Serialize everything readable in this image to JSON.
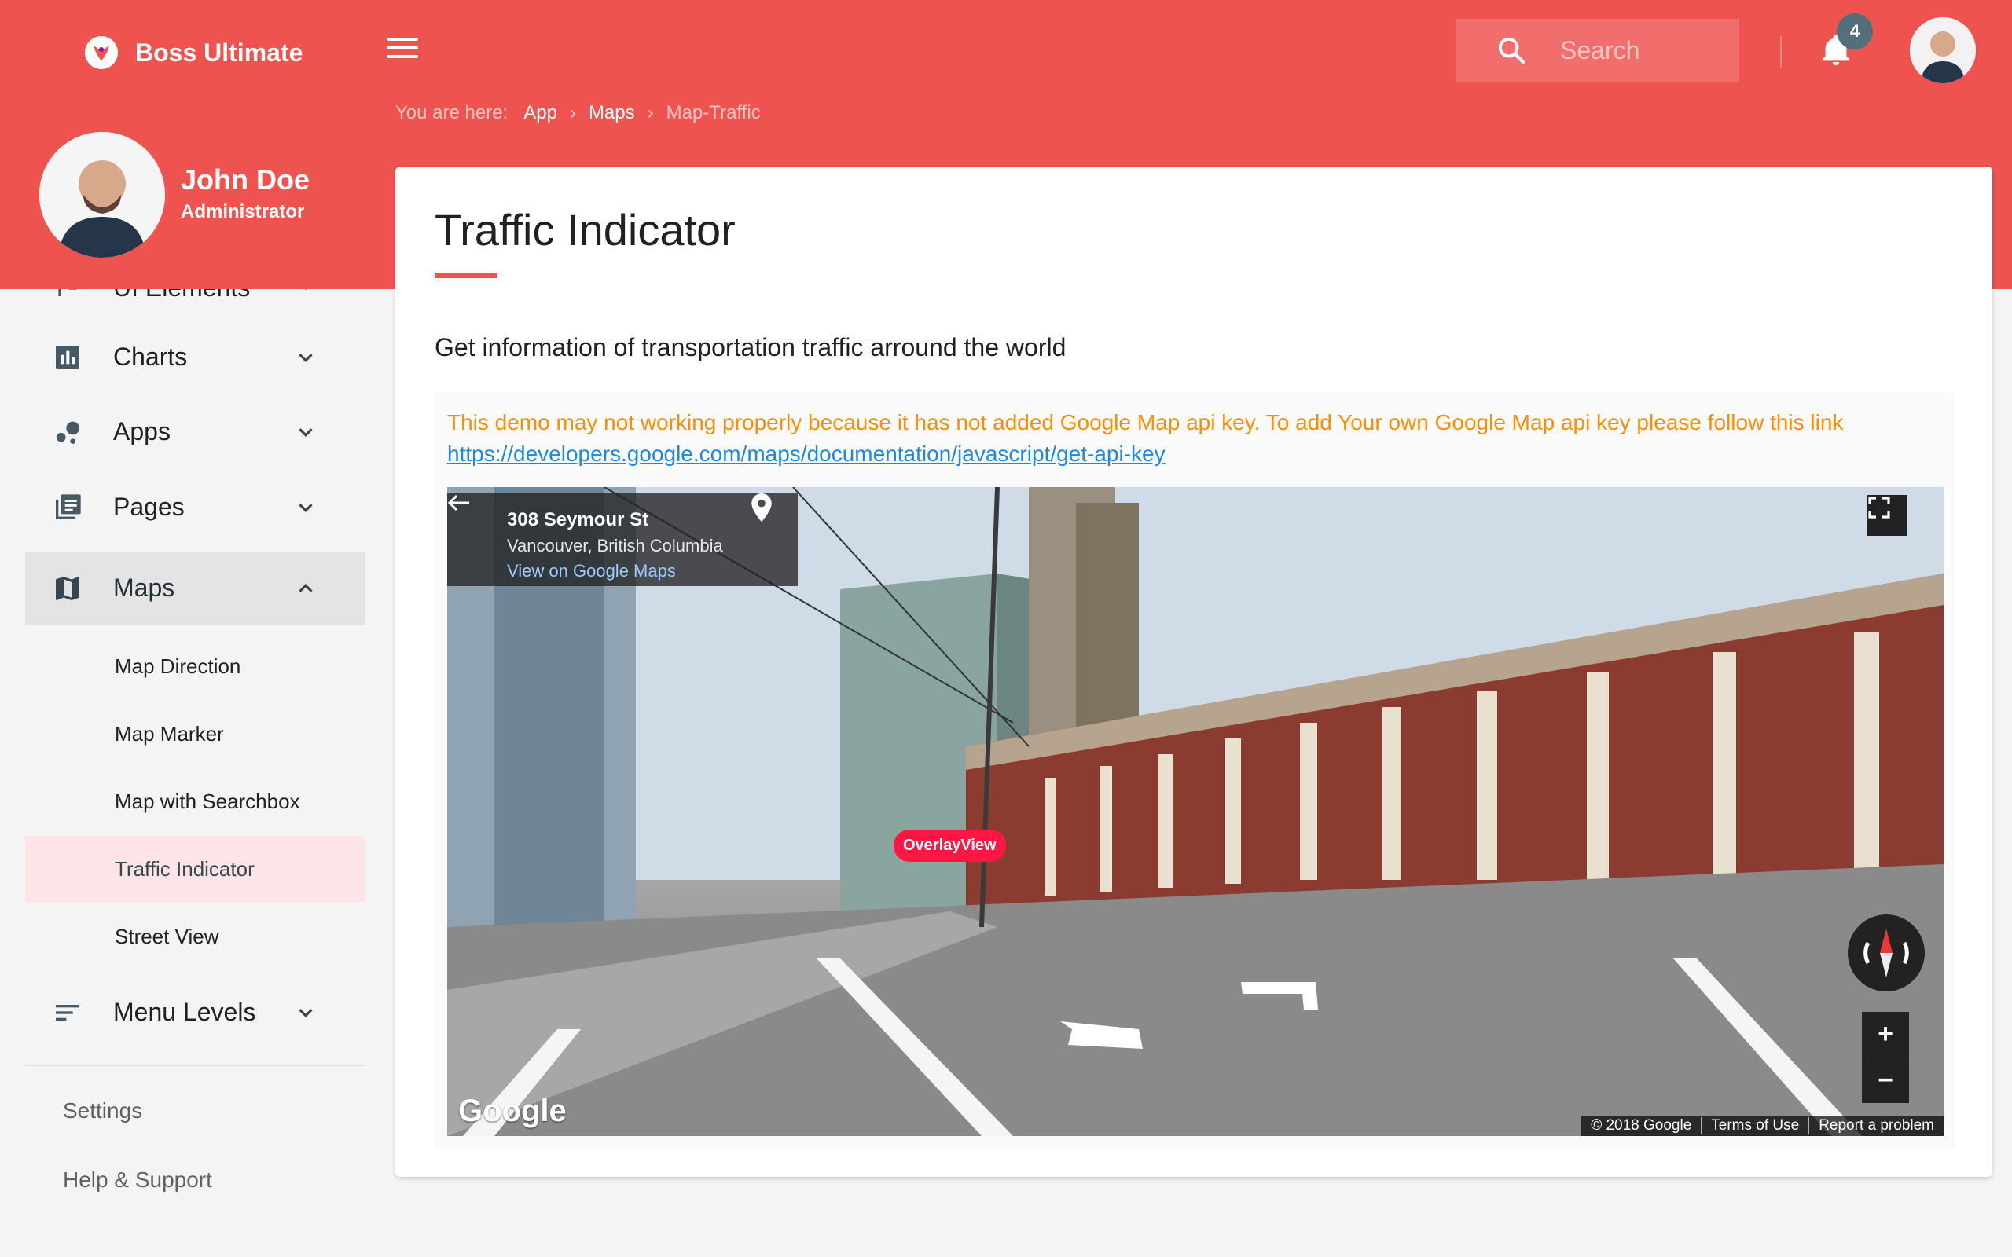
{
  "app": {
    "brand_name": "Boss Ultimate"
  },
  "header": {
    "search_placeholder": "Search",
    "notifications_count": "4"
  },
  "breadcrumb": {
    "prefix": "You are here:",
    "items": [
      "App",
      "Maps",
      "Map-Traffic"
    ]
  },
  "profile": {
    "name": "John Doe",
    "role": "Administrator"
  },
  "sidebar": {
    "partial_item": "UI Elements",
    "items": [
      {
        "label": "Charts",
        "icon": "bar-chart-icon"
      },
      {
        "label": "Apps",
        "icon": "bubbles-icon"
      },
      {
        "label": "Pages",
        "icon": "pages-icon"
      },
      {
        "label": "Maps",
        "icon": "map-icon"
      }
    ],
    "maps_sub": [
      "Map Direction",
      "Map Marker",
      "Map with Searchbox",
      "Traffic Indicator",
      "Street View"
    ],
    "menu_levels": "Menu Levels",
    "links": [
      "Settings",
      "Help & Support"
    ]
  },
  "main": {
    "title": "Traffic Indicator",
    "description": "Get information of transportation traffic arround the world",
    "notice_text": "This demo may not working properly because it has not added Google Map api key. To add Your own Google Map api key please follow this link",
    "notice_link": "https://developers.google.com/maps/documentation/javascript/get-api-key"
  },
  "streetview": {
    "address_title": "308 Seymour St",
    "address_sub": "Vancouver, British Columbia",
    "address_link": "View on Google Maps",
    "overlay_label": "OverlayView",
    "google_logo": "Google",
    "attribution": [
      "© 2018 Google",
      "Terms of Use",
      "Report a problem"
    ],
    "zoom_in": "+",
    "zoom_out": "−"
  },
  "colors": {
    "primary": "#ef5350",
    "warning": "#ff8c00",
    "link": "#1e88e5",
    "active_sub_bg": "#fde4e6"
  }
}
